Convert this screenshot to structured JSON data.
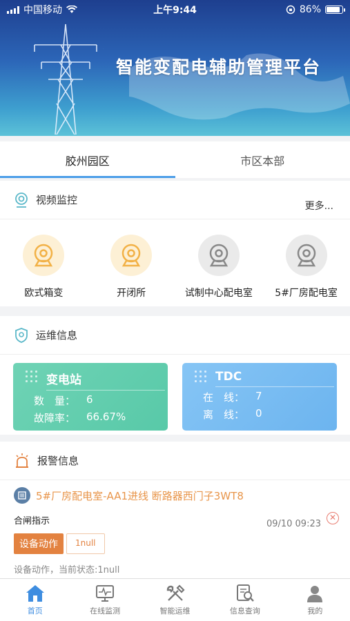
{
  "status": {
    "carrier": "中国移动",
    "time": "上午9:44",
    "battery": "86%"
  },
  "banner": {
    "title": "智能变配电辅助管理平台"
  },
  "tabs": [
    {
      "label": "胶州园区"
    },
    {
      "label": "市区本部"
    }
  ],
  "video": {
    "title": "视频监控",
    "more": "更多...",
    "cameras": [
      {
        "label": "欧式箱变"
      },
      {
        "label": "开闭所"
      },
      {
        "label": "试制中心配电室"
      },
      {
        "label": "5#厂房配电室"
      }
    ]
  },
  "ops": {
    "title": "运维信息",
    "substation": {
      "title": "变电站",
      "k1": "数　量：",
      "v1": "6",
      "k2": "故障率：",
      "v2": "66.67%"
    },
    "tdc": {
      "title": "TDC",
      "k1": "在　线：",
      "v1": "7",
      "k2": "离　线：",
      "v2": "0"
    }
  },
  "alarm": {
    "title": "报警信息",
    "item": {
      "title": "5#厂房配电室-AA1进线 断路器西门子3WT8",
      "subtitle": "合闸指示",
      "time": "09/10 09:23",
      "tag": "设备动作",
      "tag_value": "1null",
      "desc": "设备动作，当前状态:1null"
    }
  },
  "nav": [
    {
      "label": "首页",
      "icon": "home-icon"
    },
    {
      "label": "在线监测",
      "icon": "monitor-icon"
    },
    {
      "label": "智能运维",
      "icon": "tools-icon"
    },
    {
      "label": "信息查询",
      "icon": "search-doc-icon"
    },
    {
      "label": "我的",
      "icon": "user-icon"
    }
  ],
  "colors": {
    "accent": "#4a9de8",
    "warning": "#e38240",
    "green_card": "#58c9a8",
    "blue_card": "#6cb4ef"
  }
}
